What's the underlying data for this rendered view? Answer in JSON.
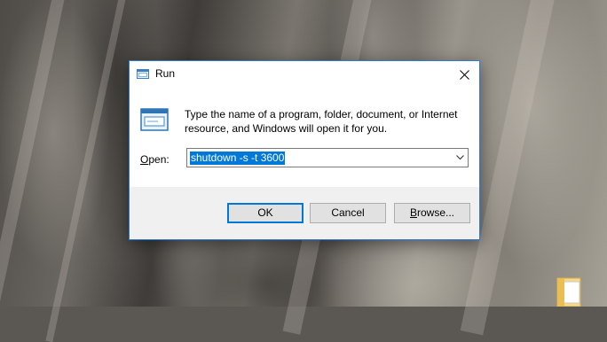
{
  "window": {
    "title": "Run",
    "close_glyph": "✕"
  },
  "dialog": {
    "description": "Type the name of a program, folder, document, or Internet resource, and Windows will open it for you.",
    "open_label_mnemonic": "O",
    "open_label_rest": "pen:",
    "open_value": "shutdown -s -t 3600"
  },
  "buttons": {
    "ok_label": "OK",
    "cancel_label": "Cancel",
    "browse_mnemonic": "B",
    "browse_rest": "rowse..."
  },
  "icons": {
    "title_icon": "run-app-icon",
    "dialog_icon": "run-app-icon",
    "desktop_icon": "folder-icon",
    "close_icon": "close-icon",
    "dropdown_icon": "chevron-down-icon"
  },
  "colors": {
    "accent": "#0078d7",
    "border": "#2b7fd0",
    "footer_bg": "#f0f0f0"
  }
}
